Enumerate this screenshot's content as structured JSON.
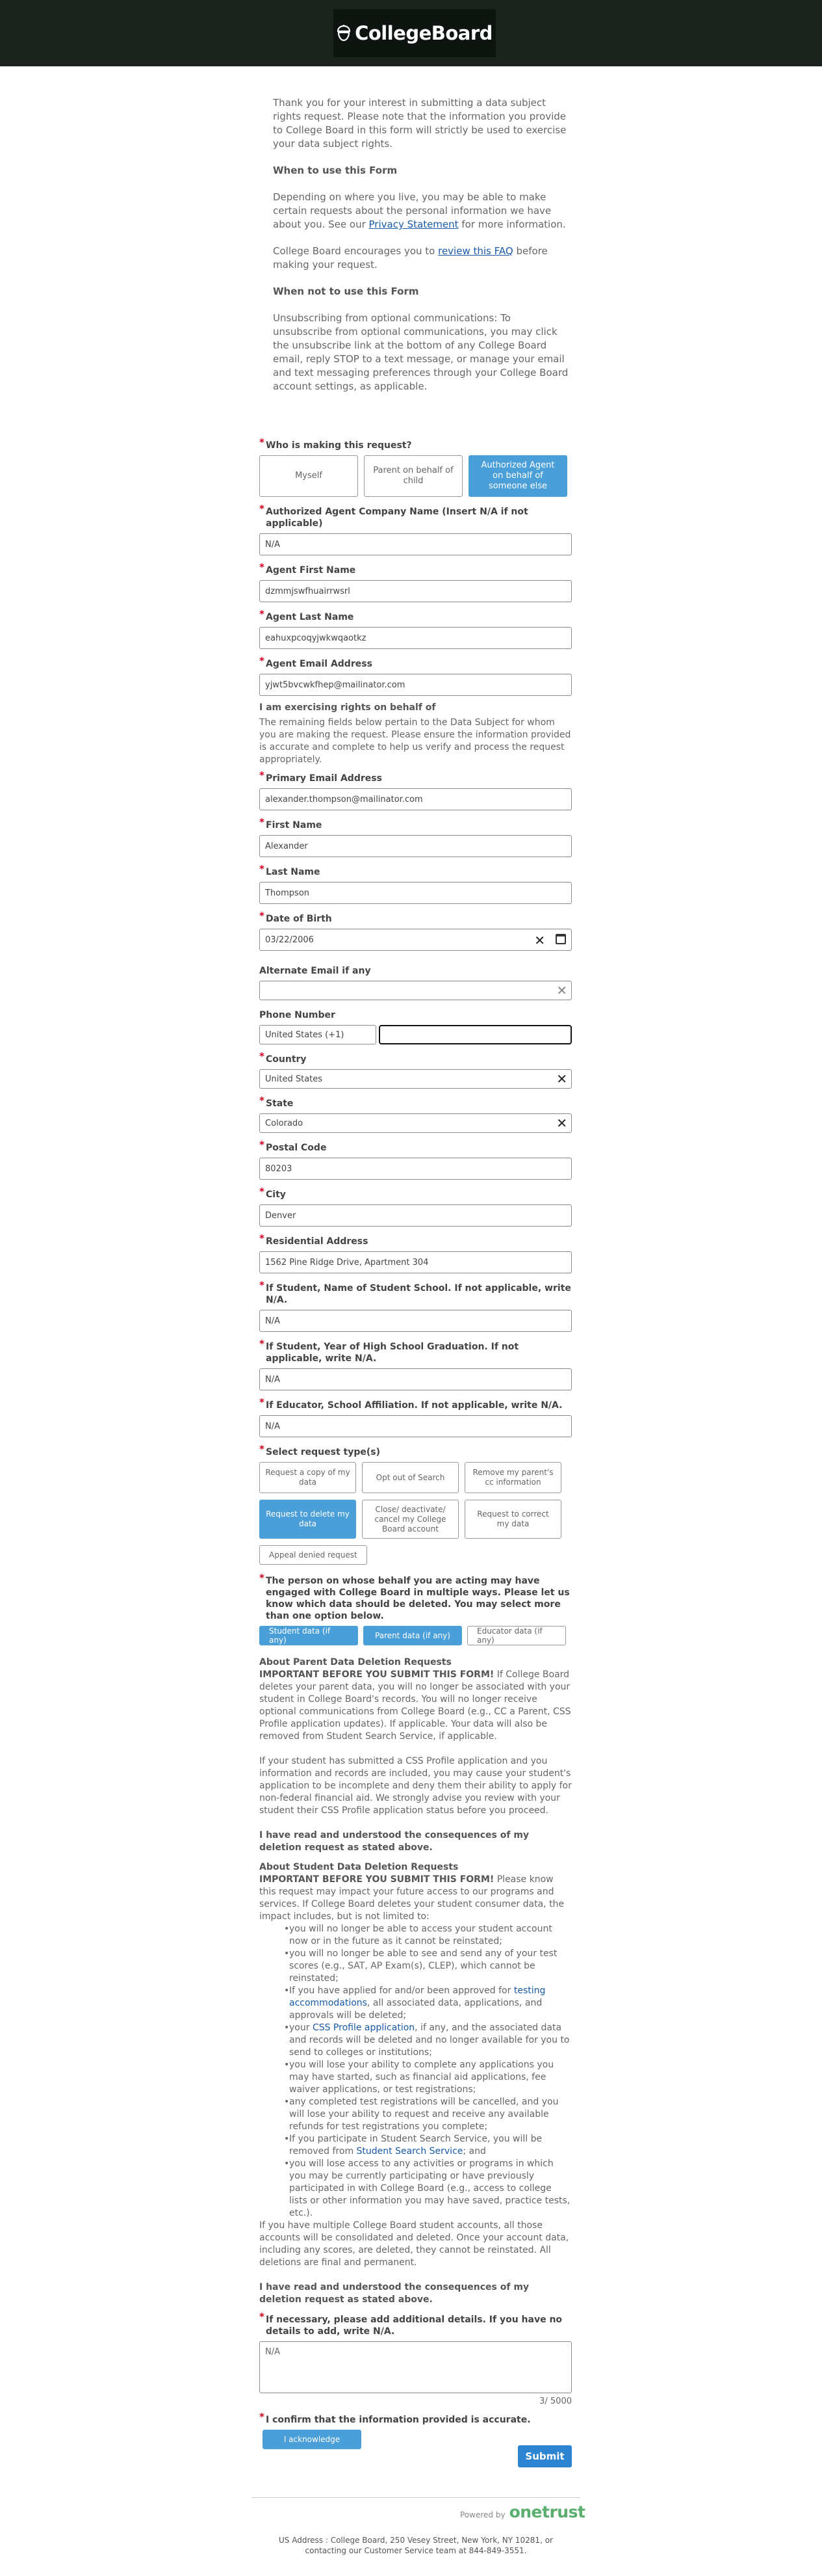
{
  "header": {
    "logo_text": "CollegeBoard"
  },
  "intro": {
    "p1": "Thank you for your interest in submitting a data subject rights request. Please note that the information you provide to College Board in this form will strictly be used to exercise your data subject rights.",
    "when_heading": "When to use this Form",
    "p2_pre": "Depending on where you live, you may be able to make certain requests about the personal information we have about you. See our ",
    "p2_link": "Privacy Statement",
    "p2_post": " for more information.",
    "p3_pre": "College Board encourages you to ",
    "p3_link": "review this FAQ",
    "p3_post": " before making your request.",
    "when_not_heading": "When not to use this Form",
    "p4": "Unsubscribing from optional communications: To unsubscribe from optional communications, you may click the unsubscribe link at the bottom of any College Board email, reply STOP to a text message, or manage your email and text messaging preferences through your College Board account settings, as applicable."
  },
  "who": {
    "label": "Who is making this request?",
    "options": [
      "Myself",
      "Parent on behalf of child",
      "Authorized Agent on behalf of someone else"
    ]
  },
  "agent": {
    "company_label": "Authorized Agent Company Name (Insert N/A if not applicable)",
    "company_value": "N/A",
    "first_label": "Agent First Name",
    "first_value": "dzmmjswfhuairrwsrl",
    "last_label": "Agent Last Name",
    "last_value": "eahuxpcoqyjwkwqaotkz",
    "email_label": "Agent Email Address",
    "email_value": "yjwt5bvcwkfhep@mailinator.com"
  },
  "behalf": {
    "heading": "I am exercising rights on behalf of",
    "desc": "The remaining fields below pertain to the Data Subject  for whom you are making the request. Please ensure the information provided is accurate and complete to help us verify and process the request appropriately."
  },
  "subject": {
    "email_label": "Primary Email Address",
    "email_value": "alexander.thompson@mailinator.com",
    "first_label": "First Name",
    "first_value": "Alexander",
    "last_label": "Last Name",
    "last_value": "Thompson",
    "dob_label": "Date of Birth",
    "dob_value": "03/22/2006",
    "alt_email_label": "Alternate Email if any",
    "alt_email_value": "",
    "phone_label": "Phone Number",
    "phone_country": "United States (+1)",
    "phone_value": "",
    "country_label": "Country",
    "country_value": "United States",
    "state_label": "State",
    "state_value": "Colorado",
    "postal_label": "Postal Code",
    "postal_value": "80203",
    "city_label": "City",
    "city_value": "Denver",
    "address_label": "Residential Address",
    "address_value": "1562 Pine Ridge Drive, Apartment 304",
    "school_label": "If Student, Name of Student School. If not applicable, write N/A.",
    "school_value": "N/A",
    "grad_label": "If Student, Year of High School Graduation. If not applicable, write N/A.",
    "grad_value": "N/A",
    "educator_label": "If Educator, School Affiliation. If not applicable, write N/A.",
    "educator_value": "N/A"
  },
  "request_types": {
    "label": "Select request type(s)",
    "row1": [
      "Request a copy of my data",
      "Opt out of Search",
      "Remove my parent's cc information"
    ],
    "row2": [
      "Request to delete my data",
      "Close/ deactivate/ cancel my College Board account",
      "Request to correct my data"
    ],
    "row3": [
      "Appeal denied request"
    ]
  },
  "data_types": {
    "label": "The person on whose behalf you are acting may have engaged with College Board in multiple ways. Please let us know which data should be deleted. You may select more than one option below.",
    "options": [
      "Student data (if any)",
      "Parent data (if any)",
      "Educator data (if any)"
    ]
  },
  "parent_deletion": {
    "heading": "About Parent Data Deletion Requests",
    "important": "IMPORTANT BEFORE YOU SUBMIT THIS FORM!",
    "p1": " If College Board deletes your parent data, you will no longer be associated with your student in College Board's records. You will no longer receive optional communications from College Board (e.g., CC a Parent, CSS Profile application updates). If applicable. Your data will also be removed from Student Search Service, if applicable.",
    "p2": "If your student has submitted a CSS Profile application and you information and records are included, you may cause your student's application to be incomplete and deny them their ability to apply for non-federal financial aid. We strongly advise you review with your student their CSS Profile application status before you proceed.",
    "ack": "I have read and understood the consequences of my deletion request as stated above."
  },
  "student_deletion": {
    "heading": "About Student Data Deletion Requests",
    "important": "IMPORTANT BEFORE YOU SUBMIT THIS FORM!",
    "intro": " Please know this request may impact your future access to our programs and services. If College Board deletes your student consumer data, the impact includes, but is not limited to:",
    "b1": "you will no longer be able to access your student account now or in the future as it cannot be reinstated;",
    "b2": "you will no longer be able to see and send any of your test scores (e.g., SAT, AP Exam(s), CLEP), which cannot be reinstated;",
    "b3_pre": " If you have applied for and/or been approved for ",
    "b3_link": "testing accommodations",
    "b3_post": ", all associated data, applications, and approvals will be deleted;",
    "b4_pre": "your ",
    "b4_link": "CSS Profile application",
    "b4_post": ", if any, and the associated data and records will be deleted and no longer available for you to send to colleges or institutions;",
    "b5": "you will lose your ability to complete any applications you may have started, such as financial aid applications, fee waiver applications, or test registrations;",
    "b6": "any completed test registrations will be cancelled, and you will lose your ability to request and receive any available refunds for test registrations you complete;",
    "b7_pre": "If you participate in Student Search Service, you will be removed from ",
    "b7_link": "Student Search Service",
    "b7_post": "; and",
    "b8": "you will lose access to any activities or programs in which you may be currently participating or have previously participated in with College Board (e.g., access to college lists or other information you may have saved, practice tests, etc.).",
    "outro": "If you have multiple College Board student accounts, all those accounts will be consolidated and deleted. Once your account data, including any scores, are deleted, they cannot be reinstated. All deletions are final and permanent.",
    "ack": "I have read and understood the consequences of my deletion request as stated above."
  },
  "details": {
    "label": "If necessary, please add additional details. If you have no details to add, write N/A.",
    "value": "N/A",
    "counter": "3/ 5000"
  },
  "confirm": {
    "label": "I confirm that the information provided is accurate.",
    "button": "I acknowledge"
  },
  "submit": "Submit",
  "footer": {
    "powered": "Powered by",
    "brand": "onetrust",
    "address": "US Address : College Board, 250 Vesey Street, New York, NY 10281, or contacting our Customer Service team at 844-849-3551."
  },
  "required_mark": "*"
}
